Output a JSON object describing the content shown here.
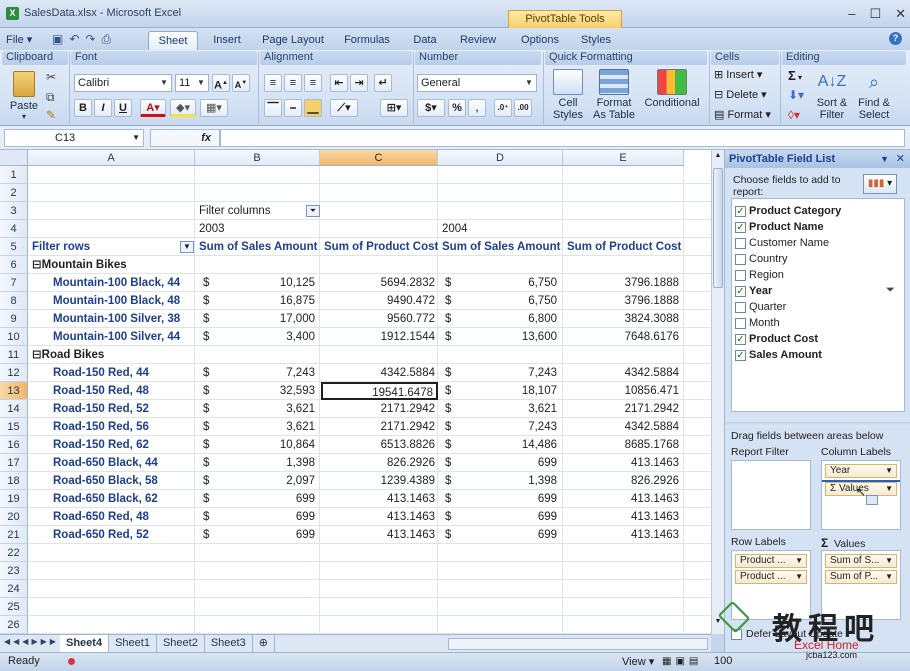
{
  "window": {
    "title": "SalesData.xlsx - Microsoft Excel",
    "context_group": "PivotTable Tools",
    "app_icon": "X"
  },
  "tabs": {
    "file": "File",
    "sheet": "Sheet",
    "insert": "Insert",
    "page_layout": "Page Layout",
    "formulas": "Formulas",
    "data": "Data",
    "review": "Review",
    "options": "Options",
    "styles": "Styles"
  },
  "ribbon": {
    "groups": {
      "clipboard": "Clipboard",
      "font": "Font",
      "alignment": "Alignment",
      "number": "Number",
      "quick_formatting": "Quick Formatting",
      "cells": "Cells",
      "editing": "Editing"
    },
    "paste": "Paste",
    "font_name": "Calibri",
    "font_size": "11",
    "bold": "B",
    "italic": "I",
    "underline": "U",
    "number_format": "General",
    "currency": "$",
    "percent": "%",
    "cell_styles": "Cell Styles",
    "format_as_table": "Format As Table",
    "conditional": "Conditional",
    "insert": "Insert",
    "delete": "Delete",
    "format": "Format",
    "sum": "Σ",
    "sort_filter": "Sort & Filter",
    "find_select": "Find & Select"
  },
  "formula_bar": {
    "name_box": "C13",
    "fx": "fx",
    "value": ""
  },
  "grid": {
    "columns": [
      "A",
      "B",
      "C",
      "D",
      "E"
    ],
    "selected_column": "C",
    "rows": [
      "1",
      "2",
      "3",
      "4",
      "5",
      "6",
      "7",
      "8",
      "9",
      "10",
      "11",
      "12",
      "13",
      "14",
      "15",
      "16",
      "17",
      "18",
      "19",
      "20",
      "21",
      "22",
      "23",
      "24",
      "25",
      "26"
    ],
    "selected_row": "13",
    "filter_columns": "Filter columns",
    "year_2003": "2003",
    "year_2004": "2004",
    "filter_rows": "Filter rows",
    "hdr_sales": "Sum of Sales Amount",
    "hdr_cost": "Sum of Product Cost",
    "group_mountain": "Mountain Bikes",
    "group_road": "Road Bikes",
    "collapse": "⊟",
    "data_rows": [
      {
        "row": 7,
        "name": "Mountain-100 Black, 44",
        "s03": "10,125",
        "c03": "5694.2832",
        "s04": "6,750",
        "c04": "3796.1888"
      },
      {
        "row": 8,
        "name": "Mountain-100 Black, 48",
        "s03": "16,875",
        "c03": "9490.472",
        "s04": "6,750",
        "c04": "3796.1888"
      },
      {
        "row": 9,
        "name": "Mountain-100 Silver, 38",
        "s03": "17,000",
        "c03": "9560.772",
        "s04": "6,800",
        "c04": "3824.3088"
      },
      {
        "row": 10,
        "name": "Mountain-100 Silver, 44",
        "s03": "3,400",
        "c03": "1912.1544",
        "s04": "13,600",
        "c04": "7648.6176"
      },
      {
        "row": 12,
        "name": "Road-150 Red, 44",
        "s03": "7,243",
        "c03": "4342.5884",
        "s04": "7,243",
        "c04": "4342.5884"
      },
      {
        "row": 13,
        "name": "Road-150 Red, 48",
        "s03": "32,593",
        "c03": "19541.6478",
        "s04": "18,107",
        "c04": "10856.471"
      },
      {
        "row": 14,
        "name": "Road-150 Red, 52",
        "s03": "3,621",
        "c03": "2171.2942",
        "s04": "3,621",
        "c04": "2171.2942"
      },
      {
        "row": 15,
        "name": "Road-150 Red, 56",
        "s03": "3,621",
        "c03": "2171.2942",
        "s04": "7,243",
        "c04": "4342.5884"
      },
      {
        "row": 16,
        "name": "Road-150 Red, 62",
        "s03": "10,864",
        "c03": "6513.8826",
        "s04": "14,486",
        "c04": "8685.1768"
      },
      {
        "row": 17,
        "name": "Road-650 Black, 44",
        "s03": "1,398",
        "c03": "826.2926",
        "s04": "699",
        "c04": "413.1463"
      },
      {
        "row": 18,
        "name": "Road-650 Black, 58",
        "s03": "2,097",
        "c03": "1239.4389",
        "s04": "1,398",
        "c04": "826.2926"
      },
      {
        "row": 19,
        "name": "Road-650 Black, 62",
        "s03": "699",
        "c03": "413.1463",
        "s04": "699",
        "c04": "413.1463"
      },
      {
        "row": 20,
        "name": "Road-650 Red, 48",
        "s03": "699",
        "c03": "413.1463",
        "s04": "699",
        "c04": "413.1463"
      },
      {
        "row": 21,
        "name": "Road-650 Red, 52",
        "s03": "699",
        "c03": "413.1463",
        "s04": "699",
        "c04": "413.1463"
      }
    ],
    "dollar": "$"
  },
  "sheets": [
    "Sheet4",
    "Sheet1",
    "Sheet2",
    "Sheet3"
  ],
  "active_sheet": "Sheet4",
  "status": {
    "ready": "Ready",
    "view": "View",
    "zoom": "100"
  },
  "panel": {
    "title": "PivotTable Field List",
    "choose": "Choose fields to add to report:",
    "fields": [
      {
        "label": "Product Category",
        "checked": true
      },
      {
        "label": "Product Name",
        "checked": true
      },
      {
        "label": "Customer Name",
        "checked": false
      },
      {
        "label": "Country",
        "checked": false
      },
      {
        "label": "Region",
        "checked": false
      },
      {
        "label": "Year",
        "checked": true
      },
      {
        "label": "Quarter",
        "checked": false
      },
      {
        "label": "Month",
        "checked": false
      },
      {
        "label": "Product Cost",
        "checked": true
      },
      {
        "label": "Sales Amount",
        "checked": true
      }
    ],
    "drag_text": "Drag fields between areas below",
    "report_filter": "Report Filter",
    "column_labels": "Column Labels",
    "row_labels": "Row Labels",
    "values": "Values",
    "col_chips": [
      "Year",
      "Values"
    ],
    "row_chips": [
      "Product ...",
      "Product ..."
    ],
    "val_chips": [
      "Sum of S...",
      "Sum of P..."
    ],
    "defer": "Defer Layout Update"
  },
  "watermark": {
    "cn": "教程吧",
    "en": "Excel Home",
    "url": "jcba123.com"
  },
  "colors": {
    "accent_blue": "#1d3f8c",
    "selection_orange": "#f2b56a",
    "check_green": "#0c7a0c"
  }
}
